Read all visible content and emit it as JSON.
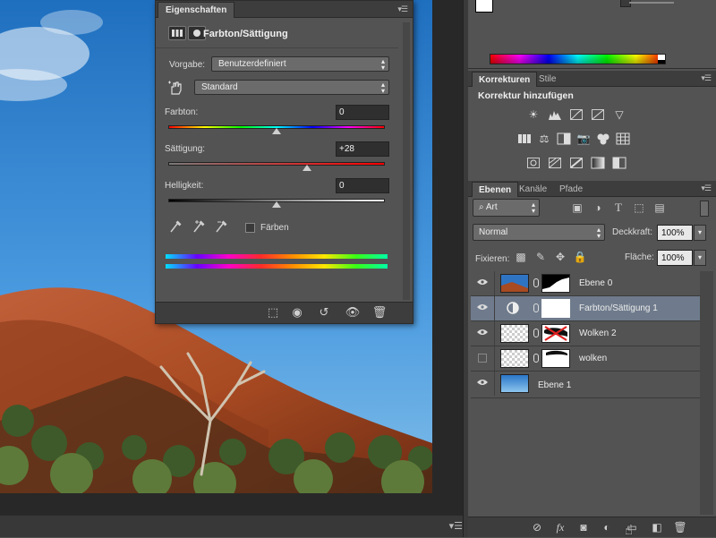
{
  "properties_panel": {
    "tab_label": "Eigenschaften",
    "title": "Farbton/Sättigung",
    "preset_label": "Vorgabe:",
    "preset_value": "Benutzerdefiniert",
    "channel_value": "Standard",
    "hue_label": "Farbton:",
    "hue_value": "0",
    "saturation_label": "Sättigung:",
    "saturation_value": "+28",
    "lightness_label": "Helligkeit:",
    "lightness_value": "0",
    "colorize_label": "Färben",
    "colorize_checked": false,
    "sliders": {
      "hue": 0.5,
      "saturation": 0.64,
      "lightness": 0.5
    }
  },
  "adjustments_panel": {
    "tabs": [
      {
        "label": "Korrekturen",
        "active": true
      },
      {
        "label": "Stile",
        "active": false
      }
    ],
    "heading": "Korrektur hinzufügen"
  },
  "layers_panel": {
    "tabs": [
      {
        "label": "Ebenen",
        "active": true
      },
      {
        "label": "Kanäle",
        "active": false
      },
      {
        "label": "Pfade",
        "active": false
      }
    ],
    "filter_label": "Art",
    "blend_mode": "Normal",
    "opacity_label": "Deckkraft:",
    "opacity_value": "100%",
    "lock_label": "Fixieren:",
    "fill_label": "Fläche:",
    "fill_value": "100%",
    "layers": [
      {
        "name": "Ebene 0",
        "visible": true,
        "selected": false
      },
      {
        "name": "Farbton/Sättigung 1",
        "visible": true,
        "selected": true
      },
      {
        "name": "Wolken 2",
        "visible": true,
        "selected": false
      },
      {
        "name": "wolken",
        "visible": false,
        "selected": false
      },
      {
        "name": "Ebene 1",
        "visible": true,
        "selected": false
      }
    ]
  },
  "colors": {
    "panel_bg": "#535353",
    "panel_dark": "#3d3d3d",
    "selected_layer": "#6f7b8c",
    "sky": "#3f8fd6",
    "rock": "#b5532b"
  }
}
